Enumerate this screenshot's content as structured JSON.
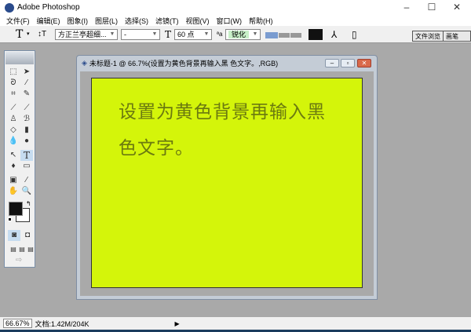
{
  "app": {
    "title": "Adobe Photoshop",
    "window_controls": {
      "minimize": "–",
      "maximize": "☐",
      "close": "✕"
    }
  },
  "menu": [
    "文件(F)",
    "编辑(E)",
    "图象(I)",
    "图层(L)",
    "选择(S)",
    "滤镜(T)",
    "视图(V)",
    "窗口(W)",
    "帮助(H)"
  ],
  "options": {
    "tool_glyph": "T",
    "font_family": "方正兰亭超细...",
    "font_style": "-",
    "font_size": "60 点",
    "antialias": "锐化",
    "antialias_bg": "#c8f0c8",
    "text_color": "#111111",
    "palette_tabs": [
      "文件浏览",
      "画笔"
    ]
  },
  "document": {
    "title": "未标题-1 @ 66.7%(设置为黄色背景再输入黑 色文字。,RGB)",
    "canvas_color": "#d4f50a",
    "text_line1": "设置为黄色背景再输入黑",
    "text_line2": "色文字。"
  },
  "tools": {
    "foreground": "#111111",
    "background": "#ffffff"
  },
  "status": {
    "zoom": "66.67%",
    "doc_info": "文档:1.42M/204K",
    "arrow": "▶"
  }
}
